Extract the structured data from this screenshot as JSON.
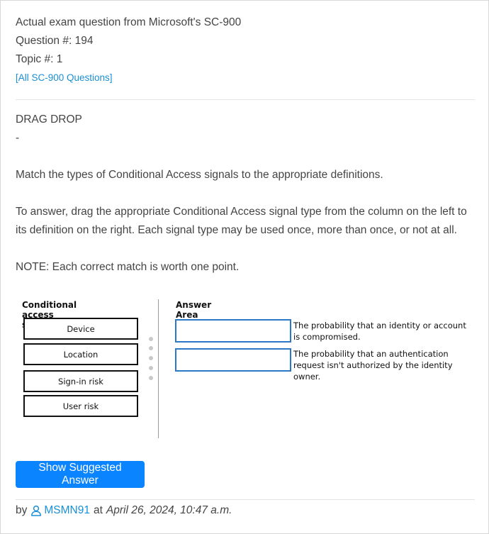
{
  "header": {
    "exam_line": "Actual exam question from Microsoft's SC-900",
    "question_line": "Question #: 194",
    "topic_line": "Topic #: 1",
    "all_questions_link": "[All SC-900 Questions]"
  },
  "question": {
    "type_label": "DRAG DROP",
    "dash": "-",
    "instruction": "Match the types of Conditional Access signals to the appropriate definitions.",
    "how_to_answer": "To answer, drag the appropriate Conditional Access signal type from the column on the left to its definition on the right. Each signal type may be used once, more than once, or not at all.",
    "note": "NOTE: Each correct match is worth one point."
  },
  "exhibit": {
    "signals_heading": "Conditional access signals",
    "answer_heading": "Answer Area",
    "signals": [
      "Device",
      "Location",
      "Sign-in risk",
      "User risk"
    ],
    "definitions": [
      "The probability that an identity or account is compromised.",
      "The probability that an authentication request isn't authorized by the identity owner."
    ]
  },
  "actions": {
    "show_answer_label": "Show Suggested Answer"
  },
  "footer": {
    "by_label": "by",
    "user_icon": "user-icon",
    "username": "MSMN91",
    "at_label": "at",
    "date": "April 26, 2024, 10:47 a.m."
  },
  "colors": {
    "link": "#1a8fd6",
    "button": "#0a84ff",
    "answer_box_border": "#2b78c6"
  }
}
